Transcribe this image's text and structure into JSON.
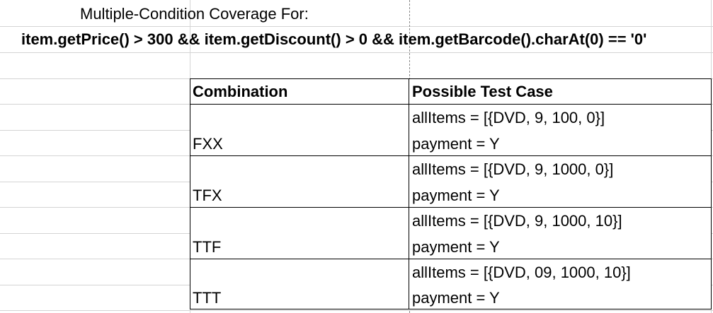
{
  "sheet": {
    "title_line1": "Multiple-Condition Coverage For:",
    "title_line2": "item.getPrice() > 300 && item.getDiscount() > 0 && item.getBarcode().charAt(0) == '0'"
  },
  "table": {
    "headers": {
      "combination": "Combination",
      "test_case": "Possible Test Case"
    },
    "rows": [
      {
        "combination": "FXX",
        "all_items": "allItems = [{DVD, 9, 100, 0}]",
        "payment": "payment = Y"
      },
      {
        "combination": "TFX",
        "all_items": "allItems = [{DVD, 9, 1000, 0}]",
        "payment": "payment = Y"
      },
      {
        "combination": "TTF",
        "all_items": "allItems = [{DVD, 9, 1000, 10}]",
        "payment": "payment = Y"
      },
      {
        "combination": "TTT",
        "all_items": "allItems = [{DVD, 09, 1000, 10}]",
        "payment": "payment = Y"
      }
    ]
  },
  "colors": {
    "gridline": "#d4d4d4",
    "page_break": "#8a8a8a",
    "border": "#000000"
  }
}
